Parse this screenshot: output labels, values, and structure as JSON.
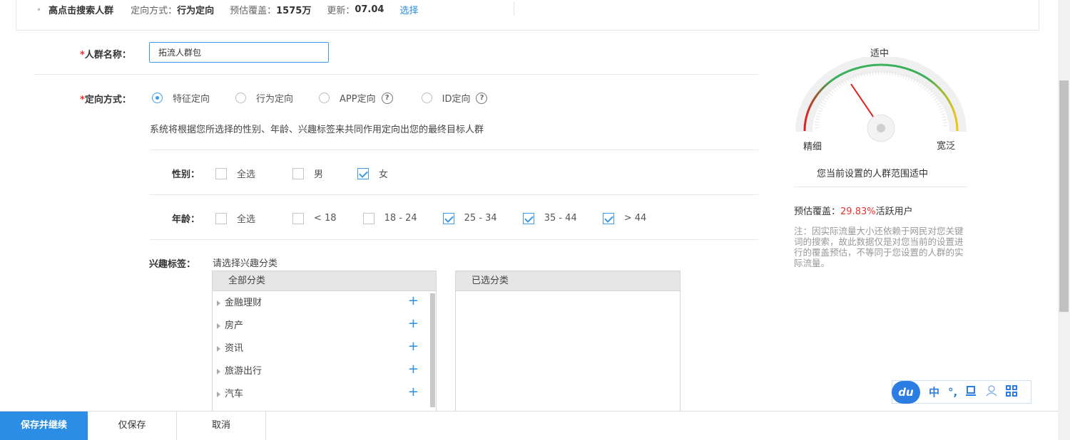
{
  "summary": {
    "crowd_name": "高点击搜索人群",
    "method_key": "定向方式：",
    "method_val": "行为定向",
    "coverage_key": "预估覆盖：",
    "coverage_val": "1575万",
    "update_key": "更新：",
    "update_val": "07.04",
    "select_link": "选择"
  },
  "form": {
    "name_label": "人群名称：",
    "name_value": "拓流人群包",
    "method_label": "定向方式：",
    "radios": [
      "特征定向",
      "行为定向",
      "APP定向",
      "ID定向"
    ],
    "radio_selected": "特征定向",
    "description": "系统将根据您所选择的性别、年龄、兴趣标签来共同作用定向出您的最终目标人群",
    "gender_label": "性别：",
    "gender_options": [
      "全选",
      "男",
      "女"
    ],
    "age_label": "年龄：",
    "age_options": [
      "全选",
      "< 18",
      "18 - 24",
      "25 - 34",
      "35 - 44",
      "> 44"
    ],
    "interest_label": "兴趣标签：",
    "interest_hint": "请选择兴趣分类",
    "all_categories_title": "全部分类",
    "selected_categories_title": "已选分类",
    "categories": [
      "金融理财",
      "房产",
      "资讯",
      "旅游出行",
      "汽车"
    ],
    "help_icon": "question-circle-icon"
  },
  "gauge": {
    "title": "适中",
    "left_label": "精细",
    "right_label": "宽泛",
    "status_text": "您当前设置的人群范围适中",
    "coverage_prefix": "预估覆盖：",
    "coverage_percent": "29.83%",
    "coverage_suffix": "活跃用户",
    "note": "注：因实际流量大小还依赖于网民对您关键词的搜索，故此数据仅是对您当前的设置进行的覆盖预估，不等同于您设置的人群的实际流量。",
    "colors": {
      "red": "#e02020",
      "green": "#3cb05a",
      "yellow": "#f0c419"
    }
  },
  "ime": {
    "logo": "du",
    "lang": "中",
    "punct": "°,",
    "items": [
      "cup-icon",
      "user-icon",
      "grid-icon"
    ]
  },
  "actions": {
    "save_continue": "保存并继续",
    "save_only": "仅保存",
    "cancel": "取消"
  },
  "colors": {
    "accent": "#2b8de3",
    "required": "#e33333"
  }
}
